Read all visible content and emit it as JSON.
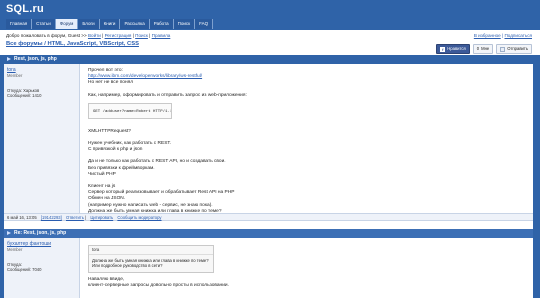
{
  "site": {
    "logo": "SQL.ru"
  },
  "nav": [
    {
      "label": "Главная",
      "active": false
    },
    {
      "label": "Статьи",
      "active": false
    },
    {
      "label": "Форум",
      "active": true
    },
    {
      "label": "Блоги",
      "active": false
    },
    {
      "label": "Книги",
      "active": false
    },
    {
      "label": "Рассылка",
      "active": false
    },
    {
      "label": "Работа",
      "active": false
    },
    {
      "label": "Поиск",
      "active": false
    },
    {
      "label": "FAQ",
      "active": false
    }
  ],
  "welcome": {
    "text": "Добро пожаловать в форум, Guest  >>",
    "links": [
      "Войти",
      "Регистрация",
      "Поиск",
      "Правила"
    ]
  },
  "breadcrumb": {
    "text": "Все форумы / HTML, JavaScript, VBScript, CSS"
  },
  "toplinks": [
    "В избранное",
    "Подписаться"
  ],
  "socials": {
    "facebook": "Нравится",
    "vk_count": "0",
    "vk_label": "Мне",
    "share": "Отправить"
  },
  "thread": {
    "title": "Rest, json, js, php"
  },
  "post1": {
    "author": "tora",
    "status": "Member",
    "location": "Откуда: Харьков",
    "messages": "Сообщений: 1410",
    "lines": [
      "Прочел вот это:",
      "http://www.ibm.com/developerworks/library/ws-restful/",
      "Но нет не все понял",
      "",
      "Как, например, оформировать и отправить запрос из web-приложения:",
      "[code]GET /adduser?name=Robert HTTP/1.1",
      "",
      "XMLHTTPRequest?",
      "",
      "Нужен учебник, как работать с REST.",
      "С привязкой к php и json",
      "",
      "Да и не только как работать с REST API, но и создавать свои.",
      "Без привязки к фреймворкам.",
      "Чистый PHP",
      "",
      "Клиент на js",
      "Сервер который реализовывает и обрабатывает Rest API на PHP",
      "Обмен на JSON.",
      "(например нужно написать web - сервис, не знаю пока).",
      "Должна же быть умная книжка или глава в книжке по теме?",
      "Или подробное руководство в сети?"
    ],
    "footer_date": "6 май 16, 13:05",
    "footer_id": "[19142293]",
    "footer_links": [
      "Ответить",
      "Цитировать",
      "Сообщить модератору"
    ]
  },
  "post2": {
    "title": "Re: Rest, json, js, php",
    "author": "бухалтер фантоши",
    "status": "Member",
    "location": "Откуда:",
    "messages": "Сообщений: 7040",
    "quote_author": "tora",
    "quote_lines": [
      "Должна же быть умная книжка или глава в книжке по теме?",
      "Или подробное руководство в сети?"
    ],
    "lines": [
      "Наваляю ввиде,",
      "клиент-серверные запросы довольно просты в использовании."
    ]
  }
}
